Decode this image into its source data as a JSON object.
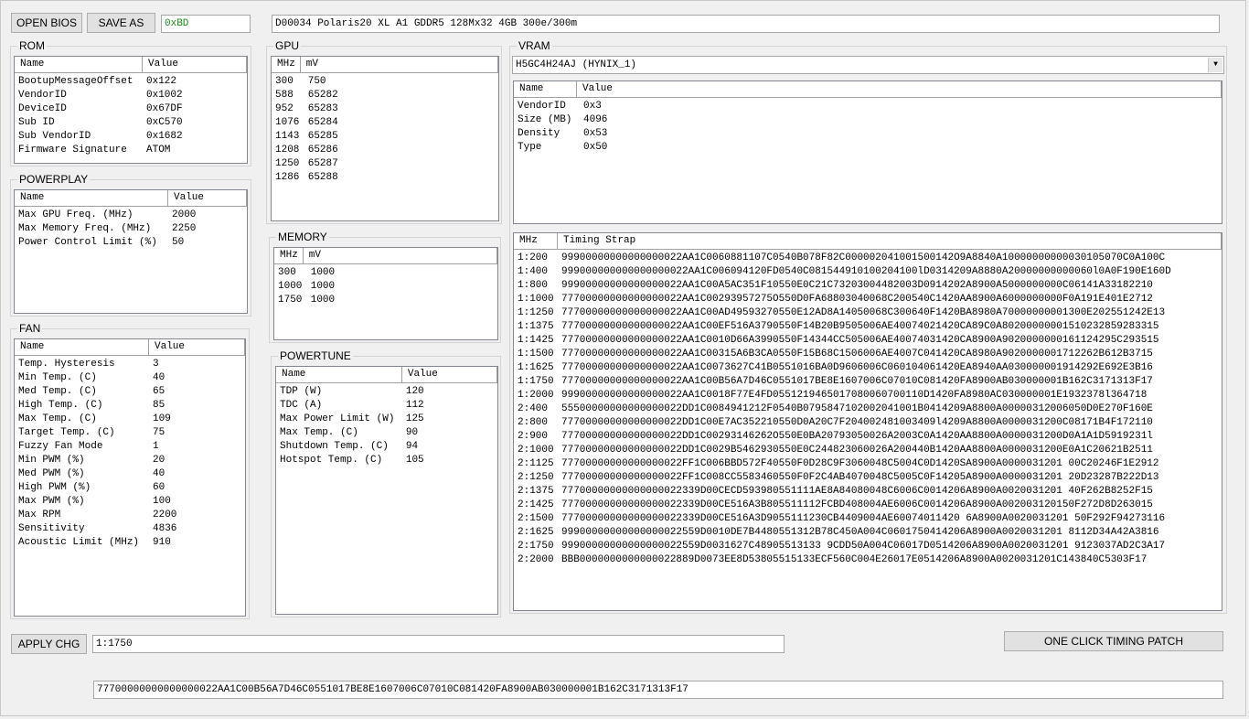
{
  "toolbar": {
    "open_bios": "OPEN BIOS",
    "save_as": "SAVE AS",
    "checksum": "0xBD",
    "bios_info": "D00034 Polaris20 XL A1 GDDR5 128Mx32 4GB 300e/300m",
    "checksum_color": "#1a8a1a"
  },
  "rom": {
    "title": "ROM",
    "col_name": "Name",
    "col_value": "Value",
    "rows": [
      {
        "name": "BootupMessageOffset",
        "value": "0x122"
      },
      {
        "name": "VendorID",
        "value": "0x1002"
      },
      {
        "name": "DeviceID",
        "value": "0x67DF"
      },
      {
        "name": "Sub ID",
        "value": "0xC570"
      },
      {
        "name": "Sub VendorID",
        "value": "0x1682"
      },
      {
        "name": "Firmware Signature",
        "value": "ATOM"
      }
    ]
  },
  "powerplay": {
    "title": "POWERPLAY",
    "col_name": "Name",
    "col_value": "Value",
    "rows": [
      {
        "name": "Max GPU Freq. (MHz)",
        "value": "2000"
      },
      {
        "name": "Max Memory Freq. (MHz)",
        "value": "2250"
      },
      {
        "name": "Power Control Limit (%)",
        "value": "50"
      }
    ]
  },
  "fan": {
    "title": "FAN",
    "col_name": "Name",
    "col_value": "Value",
    "rows": [
      {
        "name": "Temp. Hysteresis",
        "value": "3"
      },
      {
        "name": "Min Temp. (C)",
        "value": "40"
      },
      {
        "name": "Med Temp. (C)",
        "value": "65"
      },
      {
        "name": "High Temp. (C)",
        "value": "85"
      },
      {
        "name": "Max Temp. (C)",
        "value": "109"
      },
      {
        "name": "Target Temp. (C)",
        "value": "75"
      },
      {
        "name": "Fuzzy Fan Mode",
        "value": "1"
      },
      {
        "name": "Min PWM (%)",
        "value": "20"
      },
      {
        "name": "Med PWM (%)",
        "value": "40"
      },
      {
        "name": "High PWM (%)",
        "value": "60"
      },
      {
        "name": "Max PWM (%)",
        "value": "100"
      },
      {
        "name": "Max RPM",
        "value": "2200"
      },
      {
        "name": "Sensitivity",
        "value": "4836"
      },
      {
        "name": "Acoustic Limit (MHz)",
        "value": "910"
      }
    ]
  },
  "gpu": {
    "title": "GPU",
    "col_mhz": "MHz",
    "col_mv": "mV",
    "rows": [
      {
        "mhz": "300",
        "mv": "750"
      },
      {
        "mhz": "588",
        "mv": "65282"
      },
      {
        "mhz": "952",
        "mv": "65283"
      },
      {
        "mhz": "1076",
        "mv": "65284"
      },
      {
        "mhz": "1143",
        "mv": "65285"
      },
      {
        "mhz": "1208",
        "mv": "65286"
      },
      {
        "mhz": "1250",
        "mv": "65287"
      },
      {
        "mhz": "1286",
        "mv": "65288"
      }
    ]
  },
  "memory": {
    "title": "MEMORY",
    "col_mhz": "MHz",
    "col_mv": "mV",
    "rows": [
      {
        "mhz": "300",
        "mv": "1000"
      },
      {
        "mhz": "1000",
        "mv": "1000"
      },
      {
        "mhz": "1750",
        "mv": "1000"
      }
    ]
  },
  "powertune": {
    "title": "POWERTUNE",
    "col_name": "Name",
    "col_value": "Value",
    "rows": [
      {
        "name": "TDP (W)",
        "value": "120"
      },
      {
        "name": "TDC (A)",
        "value": "112"
      },
      {
        "name": "Max Power Limit (W)",
        "value": "125"
      },
      {
        "name": "Max Temp. (C)",
        "value": "90"
      },
      {
        "name": "Shutdown Temp. (C)",
        "value": "94"
      },
      {
        "name": "Hotspot Temp. (C)",
        "value": "105"
      }
    ]
  },
  "vram": {
    "title": "VRAM",
    "selected": "H5GC4H24AJ (HYNIX_1)",
    "col_name": "Name",
    "col_value": "Value",
    "rows": [
      {
        "name": "VendorID",
        "value": "0x3"
      },
      {
        "name": "Size (MB)",
        "value": "4096"
      },
      {
        "name": "Density",
        "value": "0x53"
      },
      {
        "name": "Type",
        "value": "0x50"
      }
    ],
    "col_mhz": "MHz",
    "col_strap": "Timing Strap",
    "timings": [
      {
        "mhz": "1:200",
        "strap": "99900000000000000022AA1C0060881107C0540B078F82C000002041001500142O9A8840A10000000000030105070C0A100C"
      },
      {
        "mhz": "1:400",
        "strap": "999000000000000000022AA1C006094120FD0540C081544910100204100lD0314209A8880A20000000000060l0A0F190E160D"
      },
      {
        "mhz": "1:800",
        "strap": "99900000000000000022AA1C00A5AC351F10550E0C21C73203004482003D0914202A8900A5000000000C06141A33182210"
      },
      {
        "mhz": "1:1000",
        "strap": "77700000000000000022AA1C00293957275O550D0FA68803040068C200540C1420AA8900A6000000000F0A191E401E2712"
      },
      {
        "mhz": "1:1250",
        "strap": "77700000000000000022AA1C00AD49593270550E12AD8A14050068C300640F1420BA8980A70000000001300E202551242E13"
      },
      {
        "mhz": "1:1375",
        "strap": "77700000000000000022AA1C00EF516A3790550F14B20B9505006AE40074021420CA89C0A80200000001510232859283315"
      },
      {
        "mhz": "1:1425",
        "strap": "77700000000000000022AA1C0010D66A3990550F14344CC505006AE40074031420CA8900A9020000000161124295C293515"
      },
      {
        "mhz": "1:1500",
        "strap": "77700000000000000022AA1C00315A6B3CA0550F15B68C1506006AE4007C041420CA8980A9020000001712262B612B3715"
      },
      {
        "mhz": "1:1625",
        "strap": "77700000000000000022AA1C0073627C41B0551016BA0D9606006C060104061420EA8940AA030000001914292E692E3B16"
      },
      {
        "mhz": "1:1750",
        "strap": "77700000000000000022AA1C00B56A7D46C0551017BE8E1607006C07010C081420FA8900AB030000001B162C3171313F17"
      },
      {
        "mhz": "1:2000",
        "strap": "99900000000000000022AA1C0018F77E4FD0551219465017080060700110D1420FA8980AC030000001E1932378l364718"
      },
      {
        "mhz": "2:400",
        "strap": "55500000000000000022DD1C0084941212F0540B0795847102002041001B0414209A8800A00000312006050D0E270F160E"
      },
      {
        "mhz": "2:800",
        "strap": "77700000000000000022DD1C00E7AC352210550D0A20C7F204002481003409l4209A8800A0000031200C08171B4F172110"
      },
      {
        "mhz": "2:900",
        "strap": "77700000000000000022DD1C00293146262O550E0BA20793050026A2003C0A1420AA8800A0000031200D0A1A1D5919231l"
      },
      {
        "mhz": "2:1000",
        "strap": "77700000000000000022DD1C0029B5462930550E0C244823060026A200440B1420AA8800A0000031200E0A1C20621B2511"
      },
      {
        "mhz": "2:1125",
        "strap": "77700000000000000022FF1C006BBD572F40550F0D28C9F3060048C5004C0D1420SA8900A0000031201 00C20246F1E2912"
      },
      {
        "mhz": "2:1250",
        "strap": "77700000000000000022FF1C008CC5583460550F0F2C4AB4070048C5005C0F14205A8900A0000031201 20D23287B222D13"
      },
      {
        "mhz": "2:1375",
        "strap": "77700000000000000022339D00CECD593980551111AE8A84080048C6006C0014206A8900A0020031201 40F262B8252F15"
      },
      {
        "mhz": "2:1425",
        "strap": "77700000000000000022339D00CE516A3B805511112FCBD408004AE6006C0014206A8900A002003120150F272D8D263015"
      },
      {
        "mhz": "2:1500",
        "strap": "77700000000000000022339D00CE516A3D9055111230CB4409004AE60074011420 6A8900A0020031201 50F292F94273116"
      },
      {
        "mhz": "2:1625",
        "strap": "99900000000000000022559D0010DE7B4480551312B78C450A004C0601750414206A8900A0020031201 8112D34A42A3816"
      },
      {
        "mhz": "2:1750",
        "strap": "99900000000000000022559D0031627C48905513133 9CDD50A004C06017D0514206A8900A0020031201 9123037AD2C3A17"
      },
      {
        "mhz": "2:2000",
        "strap": "BBB0000000000000022889D0073EE8D53805515133ECF560C004E26017E0514206A8900A0020031201C143840C5303F17"
      }
    ]
  },
  "bottom": {
    "apply_chg": "APPLY CHG",
    "selected_strap": "1:1750",
    "one_click": "ONE CLICK TIMING PATCH",
    "strap_value": "77700000000000000022AA1C00B56A7D46C0551017BE8E1607006C07010C081420FA8900AB030000001B162C3171313F17"
  }
}
